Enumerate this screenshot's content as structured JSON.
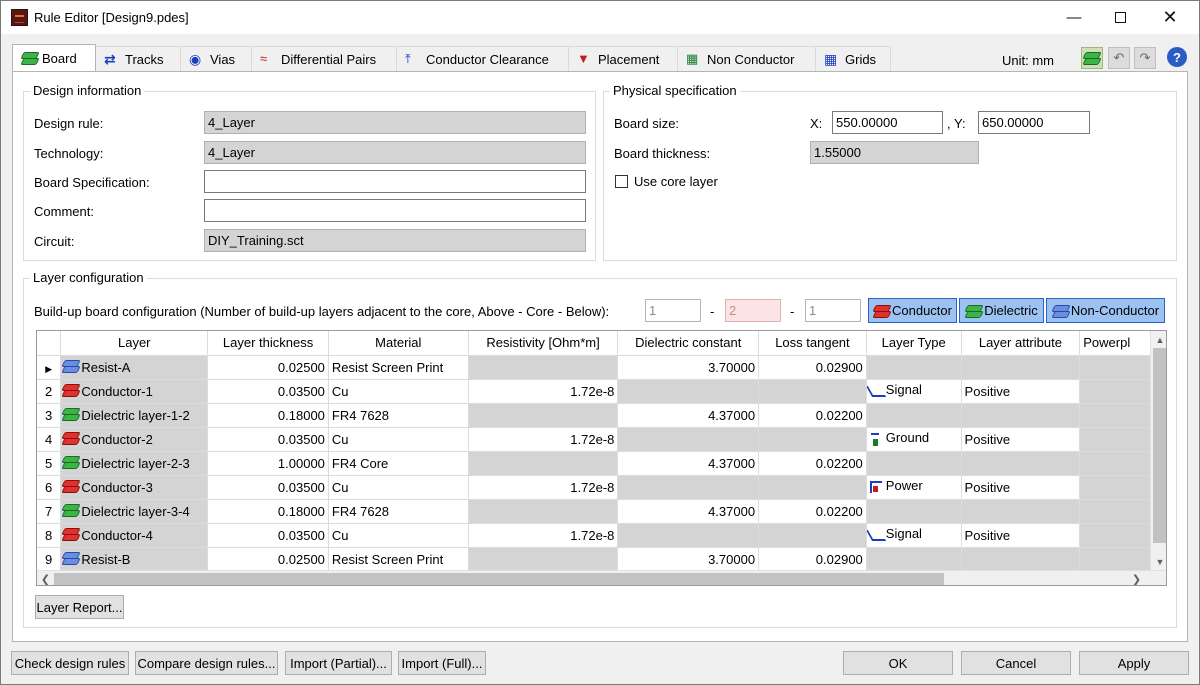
{
  "window": {
    "title": "Rule Editor [Design9.pdes]"
  },
  "tabs": [
    {
      "label": "Board",
      "icon": "board-layers-icon"
    },
    {
      "label": "Tracks",
      "icon": "tracks-icon"
    },
    {
      "label": "Vias",
      "icon": "vias-icon"
    },
    {
      "label": "Differential Pairs",
      "icon": "differential-pairs-icon"
    },
    {
      "label": "Conductor Clearance",
      "icon": "clearance-icon"
    },
    {
      "label": "Placement",
      "icon": "placement-icon"
    },
    {
      "label": "Non Conductor",
      "icon": "non-conductor-icon"
    },
    {
      "label": "Grids",
      "icon": "grids-icon"
    }
  ],
  "toolbar": {
    "unit_label": "Unit: mm",
    "help": "?"
  },
  "design_info": {
    "title": "Design information",
    "design_rule_label": "Design rule:",
    "design_rule_value": "4_Layer",
    "technology_label": "Technology:",
    "technology_value": "4_Layer",
    "board_spec_label": "Board Specification:",
    "board_spec_value": "",
    "comment_label": "Comment:",
    "comment_value": "",
    "circuit_label": "Circuit:",
    "circuit_value": "DIY_Training.sct"
  },
  "physical": {
    "title": "Physical specification",
    "board_size_label": "Board size:",
    "x_label": "X:",
    "x_value": "550.00000",
    "y_label": ", Y:",
    "y_value": "650.00000",
    "thickness_label": "Board thickness:",
    "thickness_value": "1.55000",
    "core_layer_label": "Use core layer"
  },
  "layer_config": {
    "title": "Layer configuration",
    "buildup_label": "Build-up board configuration (Number of build-up layers adjacent to the core, Above - Core - Below):",
    "above": "1",
    "sep1": "-",
    "core": "2",
    "sep2": "-",
    "below": "1",
    "conductor_btn": "Conductor",
    "dielectric_btn": "Dielectric",
    "nonconductor_btn": "Non-Conductor",
    "columns": [
      "Layer",
      "Layer thickness",
      "Material",
      "Resistivity [Ohm*m]",
      "Dielectric constant",
      "Loss tangent",
      "Layer Type",
      "Layer attribute",
      "Powerpl"
    ],
    "rows": [
      {
        "idx": "",
        "name": "Resist-A",
        "kind": "blue",
        "thickness": "0.02500",
        "material": "Resist Screen Print",
        "resistivity": "",
        "dielectric": "3.70000",
        "loss": "0.02900",
        "type": "",
        "attribute": ""
      },
      {
        "idx": "2",
        "name": "Conductor-1",
        "kind": "red",
        "thickness": "0.03500",
        "material": "Cu",
        "resistivity": "1.72e-8",
        "dielectric": "",
        "loss": "",
        "type": "Signal",
        "attribute": "Positive"
      },
      {
        "idx": "3",
        "name": "Dielectric layer-1-2",
        "kind": "green",
        "thickness": "0.18000",
        "material": "FR4 7628",
        "resistivity": "",
        "dielectric": "4.37000",
        "loss": "0.02200",
        "type": "",
        "attribute": ""
      },
      {
        "idx": "4",
        "name": "Conductor-2",
        "kind": "red",
        "thickness": "0.03500",
        "material": "Cu",
        "resistivity": "1.72e-8",
        "dielectric": "",
        "loss": "",
        "type": "Ground",
        "attribute": "Positive"
      },
      {
        "idx": "5",
        "name": "Dielectric layer-2-3",
        "kind": "green",
        "thickness": "1.00000",
        "material": "FR4 Core",
        "resistivity": "",
        "dielectric": "4.37000",
        "loss": "0.02200",
        "type": "",
        "attribute": ""
      },
      {
        "idx": "6",
        "name": "Conductor-3",
        "kind": "red",
        "thickness": "0.03500",
        "material": "Cu",
        "resistivity": "1.72e-8",
        "dielectric": "",
        "loss": "",
        "type": "Power",
        "attribute": "Positive"
      },
      {
        "idx": "7",
        "name": "Dielectric layer-3-4",
        "kind": "green",
        "thickness": "0.18000",
        "material": "FR4 7628",
        "resistivity": "",
        "dielectric": "4.37000",
        "loss": "0.02200",
        "type": "",
        "attribute": ""
      },
      {
        "idx": "8",
        "name": "Conductor-4",
        "kind": "red",
        "thickness": "0.03500",
        "material": "Cu",
        "resistivity": "1.72e-8",
        "dielectric": "",
        "loss": "",
        "type": "Signal",
        "attribute": "Positive"
      },
      {
        "idx": "9",
        "name": "Resist-B",
        "kind": "blue",
        "thickness": "0.02500",
        "material": "Resist Screen Print",
        "resistivity": "",
        "dielectric": "3.70000",
        "loss": "0.02900",
        "type": "",
        "attribute": ""
      }
    ],
    "report_btn": "Layer Report..."
  },
  "footer": {
    "check": "Check design rules",
    "compare": "Compare design rules...",
    "import_partial": "Import (Partial)...",
    "import_full": "Import (Full)...",
    "ok": "OK",
    "cancel": "Cancel",
    "apply": "Apply"
  }
}
